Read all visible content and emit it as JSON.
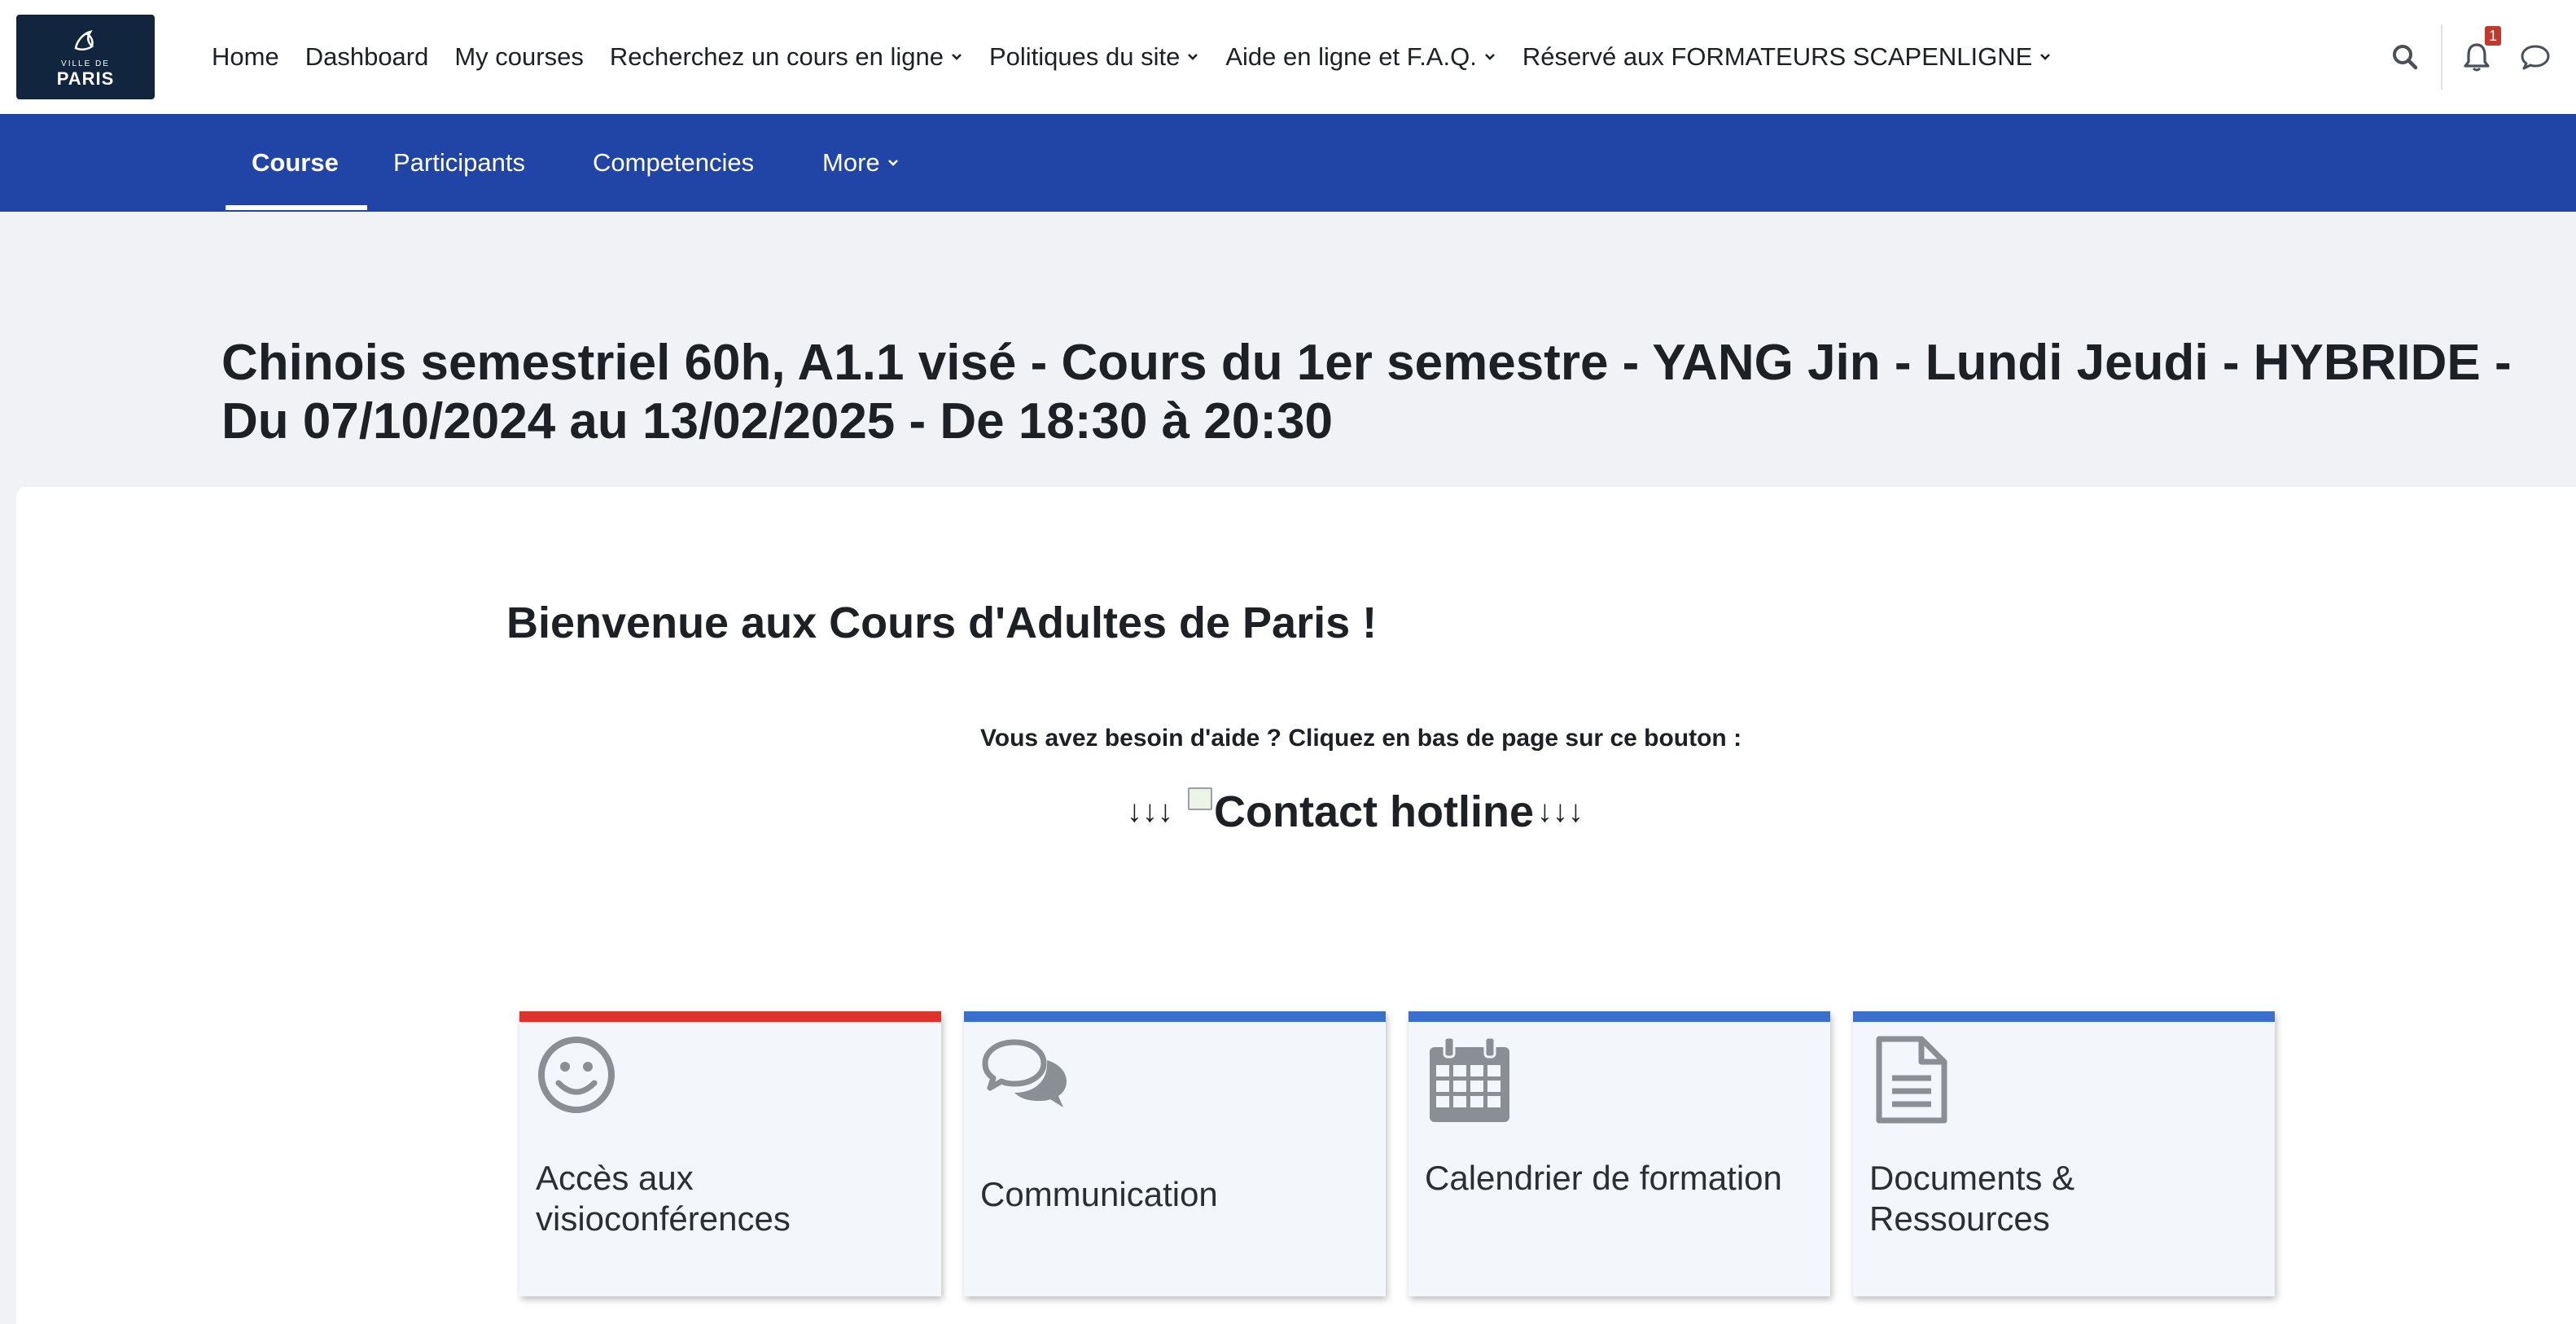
{
  "logo": {
    "line1": "VILLE DE",
    "line2": "PARIS"
  },
  "topnav": {
    "items": [
      {
        "label": "Home",
        "dropdown": false
      },
      {
        "label": "Dashboard",
        "dropdown": false
      },
      {
        "label": "My courses",
        "dropdown": false
      },
      {
        "label": "Recherchez un cours en ligne",
        "dropdown": true
      },
      {
        "label": "Politiques du site",
        "dropdown": true
      },
      {
        "label": "Aide en ligne et F.A.Q.",
        "dropdown": true
      },
      {
        "label": "Réservé aux FORMATEURS SCAPENLIGNE",
        "dropdown": true
      }
    ],
    "notification_count": "1"
  },
  "secnav": {
    "tabs": [
      {
        "label": "Course",
        "active": true
      },
      {
        "label": "Participants",
        "active": false
      },
      {
        "label": "Competencies",
        "active": false
      },
      {
        "label": "More",
        "active": false
      }
    ]
  },
  "page": {
    "title": "Chinois semestriel 60h, A1.1 visé - Cours du 1er semestre - YANG Jin - Lundi Jeudi - HYBRIDE - Du 07/10/2024 au 13/02/2025 - De 18:30 à 20:30"
  },
  "content": {
    "welcome": "Bienvenue aux Cours d'Adultes de Paris !",
    "help_text": "Vous avez besoin d'aide ? Cliquez en bas de page sur ce bouton :",
    "hotline_arrows_left": "↓↓↓",
    "hotline_alt": "Contact hotline",
    "hotline_arrows_right": "↓↓↓"
  },
  "tiles": [
    {
      "label": "Accès aux visioconférences",
      "icon": "smiley-icon",
      "bar_color": "#e0322d"
    },
    {
      "label": "Communication",
      "icon": "comments-icon",
      "bar_color": "#3a6fcf"
    },
    {
      "label": "Calendrier de formation",
      "icon": "calendar-icon",
      "bar_color": "#3a6fcf"
    },
    {
      "label": "Documents & Ressources",
      "icon": "document-icon",
      "bar_color": "#3a6fcf"
    }
  ],
  "colors": {
    "navbar_bg": "#ffffff",
    "secnav_bg": "#2145a6",
    "page_bg": "#f1f2f6",
    "logo_bg": "#12253f",
    "badge": "#c0392b"
  }
}
